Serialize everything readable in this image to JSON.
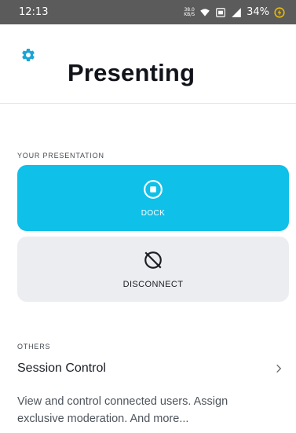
{
  "status_bar": {
    "time": "12:13",
    "net_speed_value": "38.0",
    "net_speed_unit": "KB/S",
    "battery": "34%",
    "icons": [
      "wifi-icon",
      "volte-icon",
      "signal-icon",
      "battery-icon"
    ]
  },
  "header": {
    "title": "Presenting",
    "settings_icon": "gear-icon"
  },
  "presentation": {
    "section_label": "YOUR PRESENTATION",
    "dock": {
      "label": "DOCK",
      "icon": "stop-circle-icon",
      "bg": "#0fc0e8"
    },
    "disconnect": {
      "label": "DISCONNECT",
      "icon": "disconnect-icon",
      "bg": "#ecedf1"
    }
  },
  "others": {
    "section_label": "OTHERS",
    "session_control": {
      "title": "Session Control",
      "description": "View and control connected users. Assign exclusive moderation. And more..."
    }
  },
  "colors": {
    "accent": "#1aa4d6"
  }
}
